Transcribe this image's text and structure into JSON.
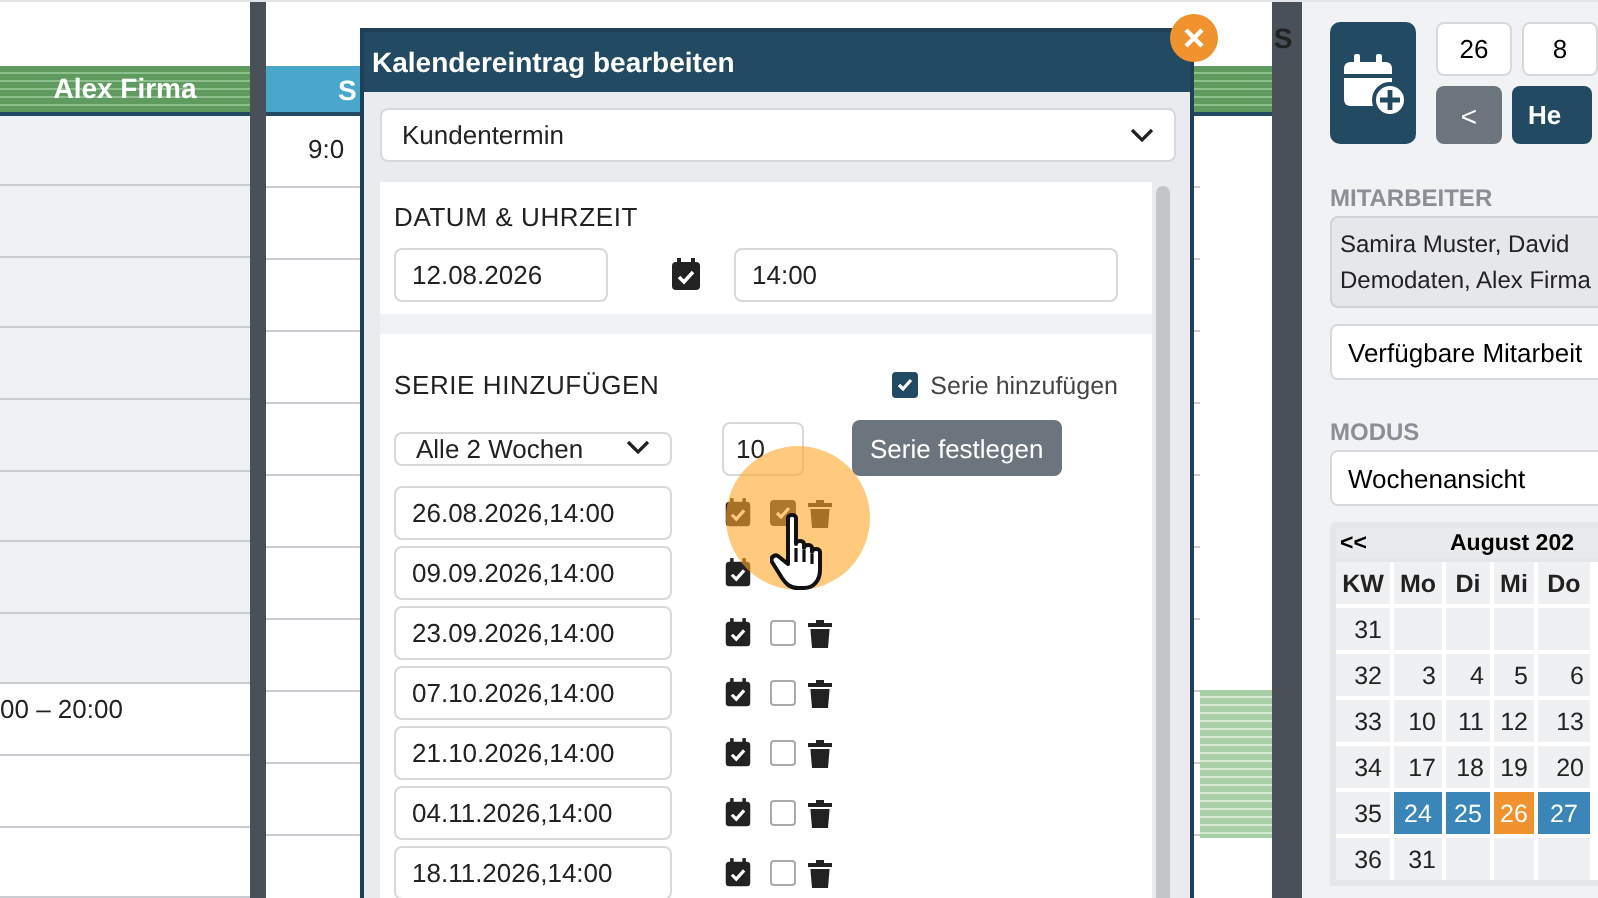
{
  "calendar": {
    "left_column": {
      "header": "Alex Firma",
      "slots": [
        {
          "shaded": true
        },
        {
          "shaded": true
        },
        {
          "shaded": true
        },
        {
          "shaded": true
        },
        {
          "shaded": true
        },
        {
          "shaded": true
        },
        {
          "shaded": true
        },
        {
          "shaded": true
        },
        {
          "shaded": false,
          "text": "00 – 20:00"
        },
        {
          "shaded": false
        },
        {
          "shaded": false
        }
      ]
    },
    "second_column": {
      "header": "S",
      "time": "9:0"
    },
    "right_strip": {
      "header": "S"
    }
  },
  "dialog": {
    "title": "Kalendereintrag bearbeiten",
    "type_select": "Kundentermin",
    "date_section": {
      "heading": "DATUM & UHRZEIT",
      "date": "12.08.2026",
      "time": "14:00"
    },
    "series_section": {
      "heading": "SERIE HINZUFÜGEN",
      "toggle": {
        "label": "Serie hinzufügen",
        "checked": true
      },
      "interval": "Alle 2 Wochen",
      "count": "10",
      "button": "Serie festlegen",
      "rows": [
        {
          "date": "26.08.2026,14:00",
          "checked": true
        },
        {
          "date": "09.09.2026,14:00"
        },
        {
          "date": "23.09.2026,14:00",
          "checked": false
        },
        {
          "date": "07.10.2026,14:00",
          "checked": false
        },
        {
          "date": "21.10.2026,14:00",
          "checked": false
        },
        {
          "date": "04.11.2026,14:00",
          "checked": false
        },
        {
          "date": "18.11.2026,14:00",
          "checked": false
        }
      ]
    }
  },
  "panel": {
    "day": "26",
    "month": "8",
    "prev_button": "<",
    "today_button": "He",
    "employees_label": "MITARBEITER",
    "employees": "Samira Muster, David Demodaten, Alex Firma",
    "available_select": "Verfügbare Mitarbeit",
    "mode_label": "MODUS",
    "mode_select": "Wochenansicht",
    "datepicker": {
      "prev": "<<",
      "month": "August 202",
      "headers": [
        "KW",
        "Mo",
        "Di",
        "Mi",
        "Do"
      ],
      "weeks": [
        {
          "kw": "31"
        },
        {
          "kw": "32",
          "days": [
            {
              "text": "3",
              "kind": "normal"
            },
            {
              "text": "4",
              "kind": "normal"
            },
            {
              "text": "5",
              "kind": "normal"
            },
            {
              "text": "6",
              "kind": "normal"
            }
          ]
        },
        {
          "kw": "33",
          "days": [
            {
              "text": "10",
              "kind": "normal"
            },
            {
              "text": "11",
              "kind": "normal"
            },
            {
              "text": "12",
              "kind": "normal"
            },
            {
              "text": "13",
              "kind": "normal"
            }
          ]
        },
        {
          "kw": "34",
          "days": [
            {
              "text": "17",
              "kind": "normal"
            },
            {
              "text": "18",
              "kind": "normal"
            },
            {
              "text": "19",
              "kind": "normal"
            },
            {
              "text": "20",
              "kind": "normal"
            }
          ]
        },
        {
          "kw": "35",
          "days": [
            {
              "text": "24",
              "kind": "range"
            },
            {
              "text": "25",
              "kind": "range"
            },
            {
              "text": "26",
              "kind": "today"
            },
            {
              "text": "27",
              "kind": "range"
            }
          ]
        },
        {
          "kw": "36",
          "days": [
            {
              "text": "31",
              "kind": "normal"
            }
          ]
        }
      ]
    }
  }
}
